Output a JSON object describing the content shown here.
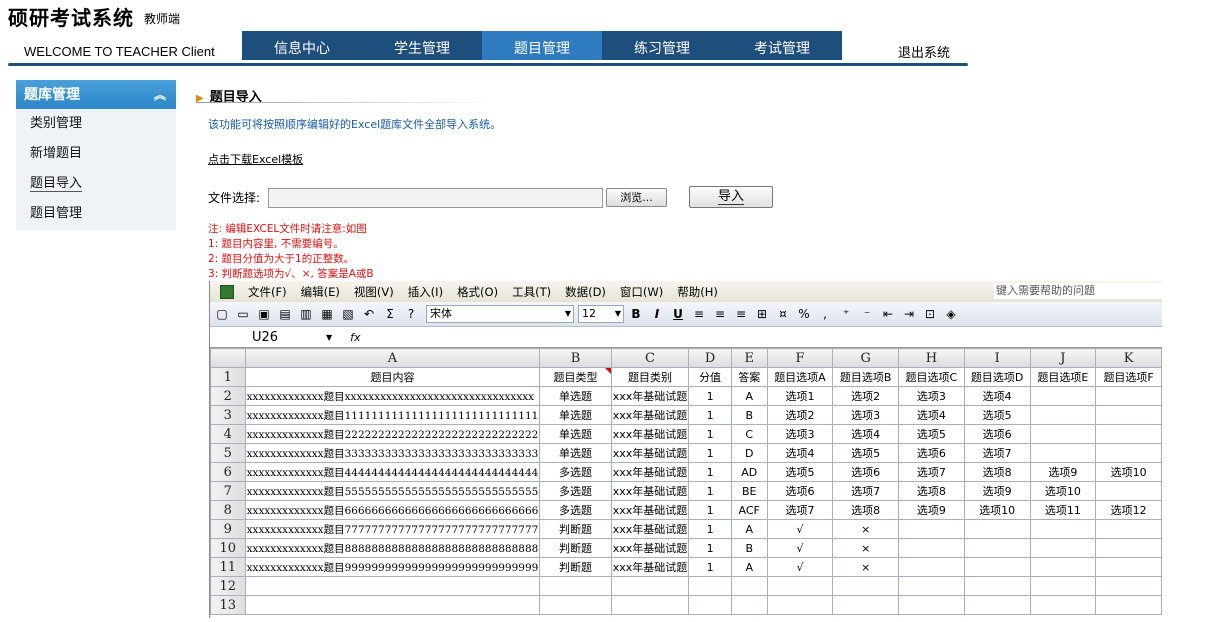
{
  "header": {
    "brand": "硕研考试系统",
    "brand_sub": "教师端",
    "welcome": "WELCOME TO TEACHER Client",
    "nav": [
      "信息中心",
      "学生管理",
      "题目管理",
      "练习管理",
      "考试管理"
    ],
    "nav_active": "题目管理",
    "logout": "退出系统",
    "colors": {
      "nav": "#1e4f7c",
      "nav_active": "#2f7bbf"
    }
  },
  "sidebar": {
    "title": "题库管理",
    "collapse_icon": "double-chevron-up-icon",
    "items": [
      "类别管理",
      "新增题目",
      "题目导入",
      "题目管理"
    ],
    "active": "题目导入"
  },
  "main": {
    "section_title": "题目导入",
    "description": "该功能可将按照顺序编辑好的Excel题库文件全部导入系统。",
    "download_link": "点击下载Excel模板",
    "file_label": "文件选择:",
    "browse_label": "浏览...",
    "import_label": "导入",
    "notes": [
      "注: 编辑EXCEL文件时请注意:如图",
      "1: 题目内容里, 不需要编号。",
      "2: 题目分值为大于1的正整数。",
      "3: 判断题选项为√、×, 答案是A或B"
    ]
  },
  "excel": {
    "menu": [
      "文件(F)",
      "编辑(E)",
      "视图(V)",
      "插入(I)",
      "格式(O)",
      "工具(T)",
      "数据(D)",
      "窗口(W)",
      "帮助(H)"
    ],
    "help_placeholder": "键入需要帮助的问题",
    "font": "宋体",
    "font_size": "12",
    "namebox": "U26",
    "fx": "fx",
    "col_letters": [
      "A",
      "B",
      "C",
      "D",
      "E",
      "F",
      "G",
      "H",
      "I",
      "J",
      "K"
    ],
    "header_row": [
      "题目内容",
      "题目类型",
      "题目类别",
      "分值",
      "答案",
      "题目选项A",
      "题目选项B",
      "题目选项C",
      "题目选项D",
      "题目选项E",
      "题目选项F"
    ],
    "rows": [
      [
        "xxxxxxxxxxxxx题目xxxxxxxxxxxxxxxxxxxxxxxxxxxxxxxx",
        "单选题",
        "xxx年基础试题",
        "1",
        "A",
        "选项1",
        "选项2",
        "选项3",
        "选项4",
        "",
        ""
      ],
      [
        "xxxxxxxxxxxxx题目11111111111111111111111111111",
        "单选题",
        "xxx年基础试题",
        "1",
        "B",
        "选项2",
        "选项3",
        "选项4",
        "选项5",
        "",
        ""
      ],
      [
        "xxxxxxxxxxxxx题目22222222222222222222222222222",
        "单选题",
        "xxx年基础试题",
        "1",
        "C",
        "选项3",
        "选项4",
        "选项5",
        "选项6",
        "",
        ""
      ],
      [
        "xxxxxxxxxxxxx题目33333333333333333333333333333",
        "单选题",
        "xxx年基础试题",
        "1",
        "D",
        "选项4",
        "选项5",
        "选项6",
        "选项7",
        "",
        ""
      ],
      [
        "xxxxxxxxxxxxx题目44444444444444444444444444444",
        "多选题",
        "xxx年基础试题",
        "1",
        "AD",
        "选项5",
        "选项6",
        "选项7",
        "选项8",
        "选项9",
        "选项10"
      ],
      [
        "xxxxxxxxxxxxx题目55555555555555555555555555555",
        "多选题",
        "xxx年基础试题",
        "1",
        "BE",
        "选项6",
        "选项7",
        "选项8",
        "选项9",
        "选项10",
        ""
      ],
      [
        "xxxxxxxxxxxxx题目66666666666666666666666666666",
        "多选题",
        "xxx年基础试题",
        "1",
        "ACF",
        "选项7",
        "选项8",
        "选项9",
        "选项10",
        "选项11",
        "选项12"
      ],
      [
        "xxxxxxxxxxxxx题目77777777777777777777777777777",
        "判断题",
        "xxx年基础试题",
        "1",
        "A",
        "√",
        "×",
        "",
        "",
        "",
        ""
      ],
      [
        "xxxxxxxxxxxxx题目88888888888888888888888888888",
        "判断题",
        "xxx年基础试题",
        "1",
        "B",
        "√",
        "×",
        "",
        "",
        "",
        ""
      ],
      [
        "xxxxxxxxxxxxx题目99999999999999999999999999999",
        "判断题",
        "xxx年基础试题",
        "1",
        "A",
        "√",
        "×",
        "",
        "",
        "",
        ""
      ],
      [
        "",
        "",
        "",
        "",
        "",
        "",
        "",
        "",
        "",
        "",
        ""
      ],
      [
        "",
        "",
        "",
        "",
        "",
        "",
        "",
        "",
        "",
        "",
        ""
      ]
    ]
  }
}
